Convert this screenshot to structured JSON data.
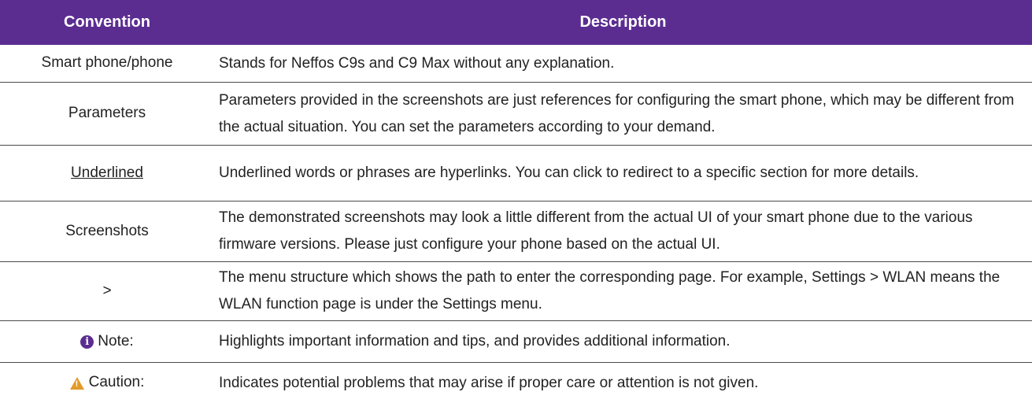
{
  "table": {
    "header": {
      "convention": "Convention",
      "description": "Description"
    },
    "rows": [
      {
        "convention": "Smart phone/phone",
        "description": "Stands for Neffos C9s and C9 Max without any explanation."
      },
      {
        "convention": "Parameters",
        "description": "Parameters provided in the screenshots are just references for configuring the smart phone, which may be different from the actual situation. You can set the parameters according to your demand."
      },
      {
        "convention": "Underlined",
        "description": "Underlined words or phrases are hyperlinks. You can click to redirect to a specific section for more details."
      },
      {
        "convention": "Screenshots",
        "description": "The demonstrated screenshots may look a little different from the actual UI of your smart phone due to the various firmware versions. Please just configure your phone based on the actual UI."
      },
      {
        "convention": ">",
        "description": "The menu structure which shows the path to enter the corresponding page. For example, Settings > WLAN  means the WLAN function page is under the Settings menu."
      },
      {
        "convention": "Note:",
        "icon": "info-icon",
        "description": "Highlights important information and tips, and provides additional information."
      },
      {
        "convention": "Caution:",
        "icon": "warning-icon",
        "description": "Indicates potential problems that may arise if proper care or attention is not given."
      }
    ]
  },
  "colors": {
    "header_bg": "#5b2d91",
    "header_text": "#ffffff",
    "info_icon": "#5b2d91",
    "warning_icon": "#e39a2a"
  }
}
